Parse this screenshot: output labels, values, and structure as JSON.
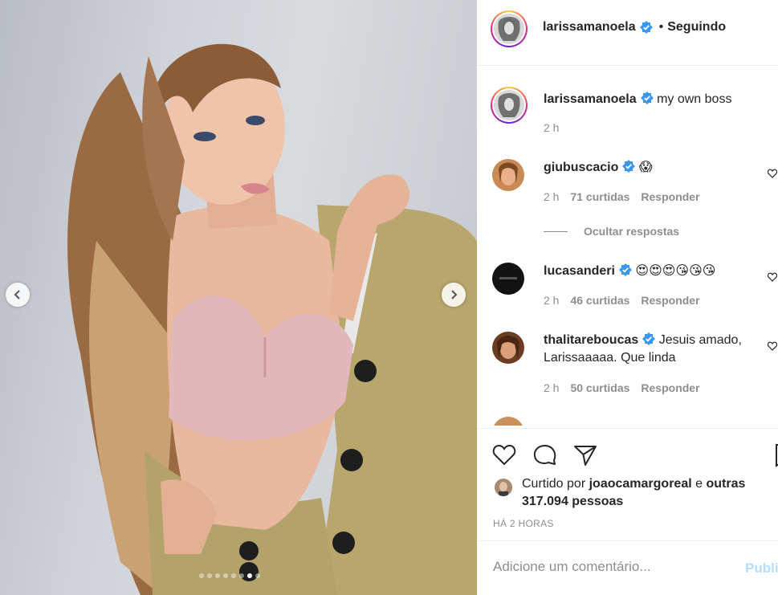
{
  "post": {
    "author": "larissamanoela",
    "follow_separator": "•",
    "follow_status": "Seguindo",
    "caption_username": "larissamanoela",
    "caption": "my own boss",
    "caption_time": "2 h",
    "carousel_dots": 8,
    "carousel_active_dot": 7
  },
  "comments": [
    {
      "username": "giubuscacio",
      "text": "😱",
      "time": "2 h",
      "likes": "71 curtidas",
      "reply": "Responder"
    },
    {
      "username": "lucasanderi",
      "text": "😍😍😍😘😘😘",
      "time": "2 h",
      "likes": "46 curtidas",
      "reply": "Responder"
    },
    {
      "username": "thalitareboucas",
      "text": "Jesuis amado, Larissaaaaa. Que linda",
      "time": "2 h",
      "likes": "50 curtidas",
      "reply": "Responder"
    }
  ],
  "hide_replies_label": "Ocultar respostas",
  "likes": {
    "prefix": "Curtido por",
    "user": "joaocamargoreal",
    "connector": "e",
    "others": "outras 317.094 pessoas"
  },
  "time_ago": "HÁ 2 HORAS",
  "add_comment": {
    "placeholder": "Adicione um comentário...",
    "publish_label": "Publi"
  },
  "colors": {
    "verified": "#3897f0",
    "link_blue_disabled": "#b2dffc",
    "secondary_text": "#8e8e8e",
    "border": "#efefef"
  }
}
